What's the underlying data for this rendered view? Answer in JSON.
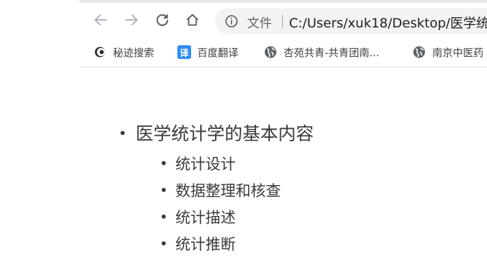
{
  "browser": {
    "scheme_label": "文件",
    "url": "C:/Users/xuk18/Desktop/医学统",
    "icons": {
      "back": "back-arrow-icon",
      "forward": "forward-arrow-icon",
      "reload": "reload-icon",
      "home": "home-icon",
      "info": "info-icon"
    }
  },
  "bookmarks": [
    {
      "label": "秘迹搜索",
      "icon": "mijisearch-icon"
    },
    {
      "label": "百度翻译",
      "icon_text": "译",
      "icon": "fanyi-icon"
    },
    {
      "label": "杏苑共青-共青团南...",
      "icon": "globe-icon"
    },
    {
      "label": "南京中医药",
      "icon": "globe-icon"
    }
  ],
  "slide": {
    "heading": "医学统计学的基本内容",
    "items": [
      "统计设计",
      "数据整理和核查",
      "统计描述",
      "统计推断"
    ]
  }
}
